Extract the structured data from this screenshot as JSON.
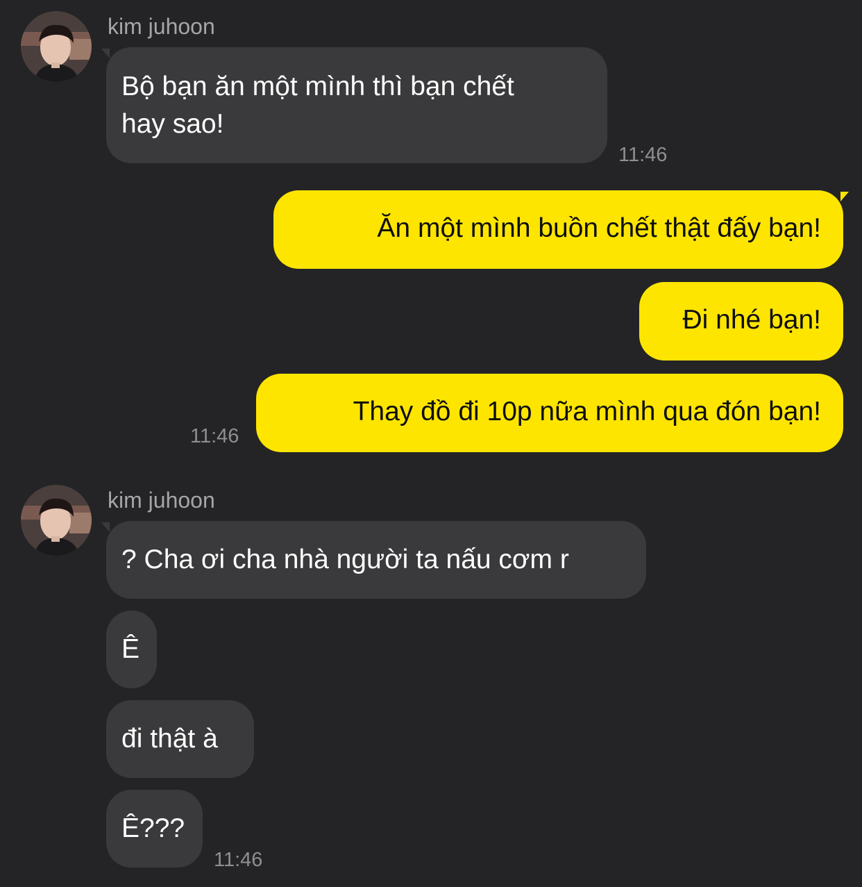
{
  "chat": {
    "groups": [
      {
        "sender": "kim juhoon",
        "messages": [
          "Bộ bạn ăn một mình thì bạn chết",
          "hay sao!"
        ],
        "time": "11:46"
      },
      {
        "messages": [
          "Ăn một mình buồn chết thật đấy bạn!",
          "Đi nhé bạn!",
          "Thay đồ đi 10p nữa mình qua đón bạn!"
        ],
        "time": "11:46"
      },
      {
        "sender": "kim juhoon",
        "messages": [
          "? Cha ơi cha nhà người ta nấu cơm r",
          "Ê",
          "đi thật à",
          "Ê???"
        ],
        "time": "11:46"
      }
    ]
  },
  "icons": {
    "avatar": "avatar-photo"
  },
  "colors": {
    "background": "#242426",
    "incoming_bubble": "#3a3a3c",
    "outgoing_bubble": "#fee500",
    "sender_name": "#a5a5aa",
    "timestamp": "#8e8e93"
  }
}
